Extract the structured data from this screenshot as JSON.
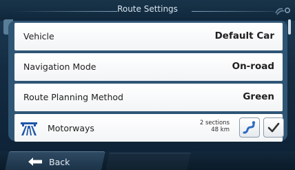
{
  "header": {
    "title": "Route Settings",
    "gps_icon": "satellite-signal-icon"
  },
  "settings": {
    "vehicle": {
      "label": "Vehicle",
      "value": "Default Car"
    },
    "navigation_mode": {
      "label": "Navigation Mode",
      "value": "On-road"
    },
    "route_planning": {
      "label": "Route Planning Method",
      "value": "Green"
    },
    "motorways": {
      "label": "Motorways",
      "icon": "motorway-icon",
      "sections": "2 sections",
      "distance": "48 km",
      "route_icon": "route-icon",
      "checked": true
    }
  },
  "footer": {
    "back_label": "Back",
    "back_icon": "arrow-left-icon"
  },
  "colors": {
    "panel": "#2f5575",
    "background": "#142c42",
    "motorway_blue": "#1f56a8"
  }
}
